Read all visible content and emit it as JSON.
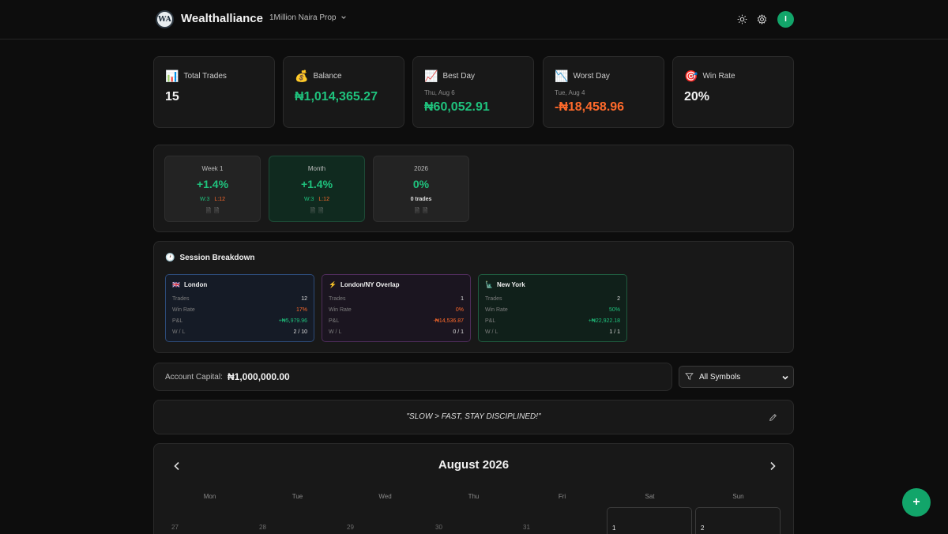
{
  "header": {
    "logo_text": "WA",
    "brand": "Wealthalliance",
    "account": "1Million Naira Prop",
    "avatar_initial": "I"
  },
  "stats": [
    {
      "label": "Total Trades",
      "icon": "bar-chart-icon",
      "sub": "",
      "value": "15"
    },
    {
      "label": "Balance",
      "icon": "money-bag-icon",
      "sub": "",
      "value": "₦1,014,365.27"
    },
    {
      "label": "Best Day",
      "icon": "chart-up-icon",
      "sub": "Thu, Aug 6",
      "value": "₦60,052.91"
    },
    {
      "label": "Worst Day",
      "icon": "chart-down-icon",
      "sub": "Tue, Aug 4",
      "value": "-₦18,458.96"
    },
    {
      "label": "Win Rate",
      "icon": "target-icon",
      "sub": "",
      "value": "20%"
    }
  ],
  "periods": [
    {
      "label": "Week 1",
      "value": "+1.4%",
      "w": "W:3",
      "l": "L:12",
      "trades": ""
    },
    {
      "label": "Month",
      "value": "+1.4%",
      "w": "W:3",
      "l": "L:12",
      "trades": ""
    },
    {
      "label": "2026",
      "value": "0%",
      "w": "",
      "l": "",
      "trades": "0 trades"
    }
  ],
  "sessions": {
    "title": "Session Breakdown",
    "row_labels": {
      "trades": "Trades",
      "win_rate": "Win Rate",
      "pnl": "P&L",
      "wl": "W / L"
    },
    "items": [
      {
        "name": "London",
        "trades": "12",
        "win_rate": "17%",
        "pnl": "+₦5,979.96",
        "wl": "2 / 10"
      },
      {
        "name": "London/NY Overlap",
        "trades": "1",
        "win_rate": "0%",
        "pnl": "-₦14,536.87",
        "wl": "0 / 1"
      },
      {
        "name": "New York",
        "trades": "2",
        "win_rate": "50%",
        "pnl": "+₦22,922.18",
        "wl": "1 / 1"
      }
    ]
  },
  "capital": {
    "label": "Account Capital:",
    "value": "₦1,000,000.00"
  },
  "symbol_filter": {
    "selected": "All Symbols"
  },
  "quote": {
    "text": "\"SLOW > FAST, STAY DISCIPLINED!\""
  },
  "calendar": {
    "title": "August 2026",
    "weekdays": [
      "Mon",
      "Tue",
      "Wed",
      "Thu",
      "Fri",
      "Sat",
      "Sun"
    ],
    "first_row": [
      "27",
      "28",
      "29",
      "30",
      "31",
      "1",
      "2"
    ]
  },
  "fab": {
    "label": "+"
  },
  "colors": {
    "accent": "#12a56a",
    "positive": "#1fc27d",
    "negative": "#ff6a2b",
    "background": "#0d0d0d",
    "card": "#181818"
  }
}
